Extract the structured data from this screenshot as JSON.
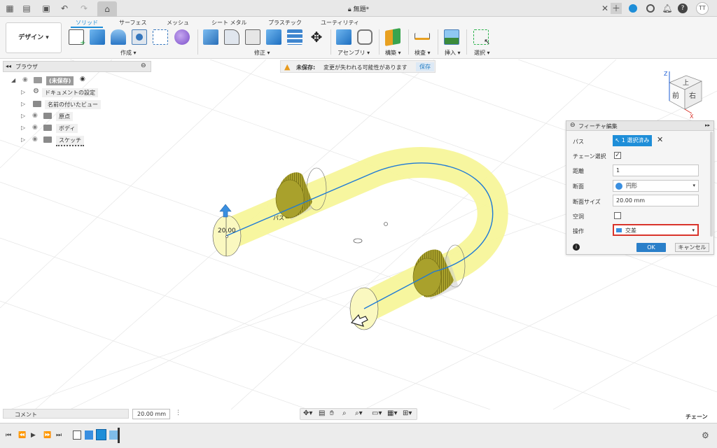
{
  "titlebar": {
    "document_title": "無題*",
    "user_initials": "TT"
  },
  "toolbar": {
    "workspace_button": "デザイン",
    "tabs": [
      "ソリッド",
      "サーフェス",
      "メッシュ",
      "シート メタル",
      "プラスチック",
      "ユーティリティ"
    ],
    "groups": [
      "作成",
      "修正",
      "アセンブリ",
      "構築",
      "検査",
      "挿入",
      "選択"
    ]
  },
  "browser": {
    "title": "ブラウザ",
    "root_label": "(未保存)",
    "items": [
      "ドキュメントの設定",
      "名前の付いたビュー",
      "原点",
      "ボディ",
      "スケッチ"
    ]
  },
  "warning": {
    "title": "未保存:",
    "message": "変更が失われる可能性があります",
    "save_label": "保存"
  },
  "viewcube": {
    "top": "上",
    "front": "前",
    "right": "右",
    "z_axis": "Z",
    "x_axis": "X"
  },
  "dialog": {
    "title": "フィーチャ編集",
    "path_label": "パス",
    "path_selection": "1 選択済み",
    "chain_label": "チェーン選択",
    "chain_checked": true,
    "distance_label": "距離",
    "distance_value": "1",
    "section_label": "断面",
    "section_value": "円形",
    "section_size_label": "断面サイズ",
    "section_size_value": "20.00 mm",
    "hollow_label": "空洞",
    "hollow_checked": false,
    "operation_label": "操作",
    "operation_value": "交差",
    "ok_label": "OK",
    "cancel_label": "キャンセル"
  },
  "canvas": {
    "dimension_label": "20.00",
    "path_label": "パス"
  },
  "bottom": {
    "comment_label": "コメント",
    "dimension_field": "20.00 mm",
    "chain_mode": "チェーン"
  },
  "colors": {
    "accent": "#1e8ed8",
    "pipe_fill": "#f7f59a",
    "path_line": "#1e7ad6",
    "highlight_border": "#d9342b",
    "solid_olive": "#a9a12c"
  }
}
